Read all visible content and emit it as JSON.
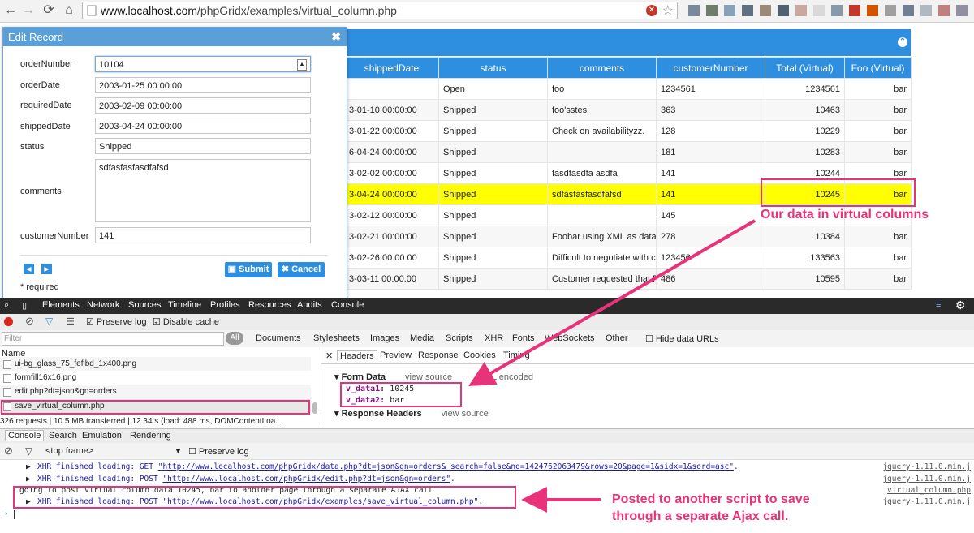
{
  "browser": {
    "url_host": "www.localhost.com",
    "url_path": "/phpGridx/examples/virtual_column.php"
  },
  "grid": {
    "columns": [
      "shippedDate",
      "status",
      "comments",
      "customerNumber",
      "Total (Virtual)",
      "Foo (Virtual)"
    ],
    "rows": [
      [
        "",
        "Open",
        "foo",
        "1234561",
        "1234561",
        "bar"
      ],
      [
        "3-01-10 00:00:00",
        "Shipped",
        "foo'sstes",
        "363",
        "10463",
        "bar"
      ],
      [
        "3-01-22 00:00:00",
        "Shipped",
        "Check on availabilityzz.",
        "128",
        "10229",
        "bar"
      ],
      [
        "6-04-24 00:00:00",
        "Shipped",
        "",
        "181",
        "10283",
        "bar"
      ],
      [
        "3-02-02 00:00:00",
        "Shipped",
        "fasdfasdfa asdfa",
        "141",
        "10244",
        "bar"
      ],
      [
        "3-04-24 00:00:00",
        "Shipped",
        "sdfasfasfasdfafsd",
        "141",
        "10245",
        "bar"
      ],
      [
        "3-02-12 00:00:00",
        "Shipped",
        "",
        "145",
        "",
        ""
      ],
      [
        "3-02-21 00:00:00",
        "Shipped",
        "Foobar using XML as datasou",
        "278",
        "10384",
        "bar"
      ],
      [
        "3-02-26 00:00:00",
        "Shipped",
        "Difficult to negotiate with cus",
        "123456",
        "133563",
        "bar"
      ],
      [
        "3-03-11 00:00:00",
        "Shipped",
        "Customer requested that Fe",
        "486",
        "10595",
        "bar"
      ]
    ],
    "highlight_row": 5
  },
  "dialog": {
    "title": "Edit Record",
    "fields": [
      {
        "label": "orderNumber",
        "value": "10104"
      },
      {
        "label": "orderDate",
        "value": "2003-01-25 00:00:00"
      },
      {
        "label": "requiredDate",
        "value": "2003-02-09 00:00:00"
      },
      {
        "label": "shippedDate",
        "value": "2003-04-24 00:00:00"
      },
      {
        "label": "status",
        "value": "Shipped"
      },
      {
        "label": "comments",
        "value": "sdfasfasfasdfafsd"
      },
      {
        "label": "customerNumber",
        "value": "141"
      }
    ],
    "submit_label": "Submit",
    "cancel_label": "Cancel",
    "required_note": "* required"
  },
  "devtools": {
    "tabs": [
      "Elements",
      "Network",
      "Sources",
      "Timeline",
      "Profiles",
      "Resources",
      "Audits",
      "Console"
    ],
    "preserve_log": "Preserve log",
    "disable_cache": "Disable cache",
    "filter_placeholder": "Filter",
    "all_label": "All",
    "filter_types": [
      "Documents",
      "Stylesheets",
      "Images",
      "Media",
      "Scripts",
      "XHR",
      "Fonts",
      "WebSockets",
      "Other"
    ],
    "hide_data_urls": "Hide data URLs",
    "name_header": "Name",
    "requests": [
      "ui-bg_glass_75_fefibd_1x400.png",
      "formfill16x16.png",
      "edit.php?dt=json&gn=orders",
      "save_virtual_column.php"
    ],
    "status_text": "326 requests | 10.5 MB transferred | 12.34 s (load: 488 ms, DOMContentLoa...",
    "detail_tabs": [
      "Headers",
      "Preview",
      "Response",
      "Cookies",
      "Timing"
    ],
    "form_data_title": "Form Data",
    "view_source": "view source",
    "url_encoded": "URL encoded",
    "form_data": [
      {
        "key": "v_data1:",
        "value": "10245"
      },
      {
        "key": "v_data2:",
        "value": "bar"
      }
    ],
    "response_headers_title": "Response Headers"
  },
  "console": {
    "tabs": [
      "Console",
      "Search",
      "Emulation",
      "Rendering"
    ],
    "frame": "<top frame>",
    "preserve_log": "Preserve log",
    "lines": [
      {
        "prefix": "XHR finished loading: GET ",
        "url": "\"http://www.localhost.com/phpGridx/data.php?dt=json&gn=orders&_search=false&nd=1424762063479&rows=20&page=1&sidx=1&sord=asc\"",
        "suffix": ".",
        "source": "jquery-1.11.0.min.j"
      },
      {
        "prefix": "XHR finished loading: POST ",
        "url": "\"http://www.localhost.com/phpGridx/edit.php?dt=json&gn=orders\"",
        "suffix": ".",
        "source": "jquery-1.11.0.min.j"
      },
      {
        "prefix": "",
        "url": "",
        "suffix": "going to post virtual column data 10245, bar to another page through a separate AJAX call",
        "source": "virtual_column.php"
      },
      {
        "prefix": "XHR finished loading: POST ",
        "url": "\"http://www.localhost.com/phpGridx/examples/save_virtual_column.php\"",
        "suffix": ".",
        "source": "jquery-1.11.0.min.j"
      }
    ]
  },
  "annotations": {
    "virtual_columns": "Our data in virtual columns",
    "posted_line1": "Posted to another script to save",
    "posted_line2": "through a  separate Ajax call."
  },
  "colors": {
    "accent": "#2e8fe0",
    "highlight": "#ffff00",
    "annotation": "#e8337a"
  }
}
